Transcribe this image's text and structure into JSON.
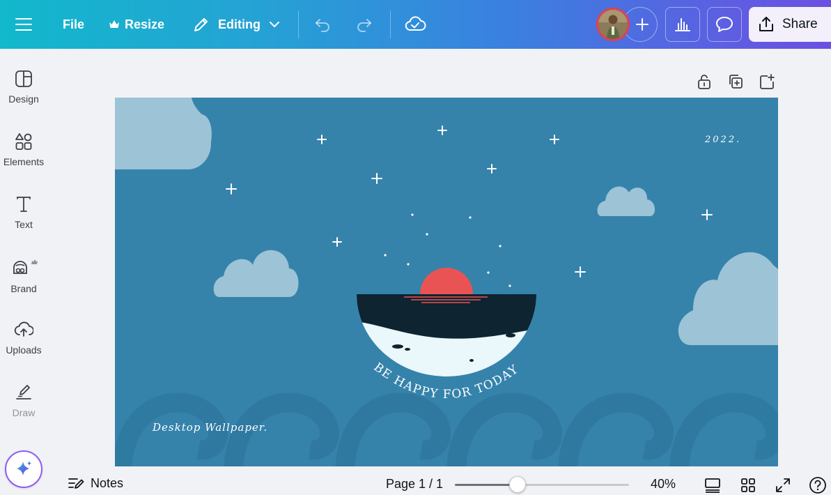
{
  "topbar": {
    "file_label": "File",
    "resize_label": "Resize",
    "editing_label": "Editing",
    "share_label": "Share"
  },
  "icons": {
    "menu": "hamburger-menu-icon",
    "crown": "crown-icon",
    "pencil": "pencil-icon",
    "chevron": "chevron-down-icon",
    "undo": "undo-icon",
    "redo": "redo-icon",
    "cloud": "cloud-check-icon",
    "add": "plus-icon",
    "analytics": "bar-chart-icon",
    "comment": "comment-icon",
    "share": "share-upload-icon"
  },
  "sidebar": {
    "items": [
      {
        "label": "Design"
      },
      {
        "label": "Elements"
      },
      {
        "label": "Text"
      },
      {
        "label": "Brand"
      },
      {
        "label": "Uploads"
      },
      {
        "label": "Draw"
      }
    ]
  },
  "canvas": {
    "year_text": "2022.",
    "arc_text": "BE HAPPY FOR TODAY.",
    "bottom_text": "Desktop Wallpaper.",
    "background_color": "#3583ab",
    "cloud_color": "#9cc3d6",
    "sun_color": "#ea5354",
    "sea_color": "#0e2430"
  },
  "footer": {
    "notes_label": "Notes",
    "page_indicator": "Page 1 / 1",
    "zoom_label": "40%",
    "zoom_fraction": 0.36
  },
  "colors": {
    "accent_start": "#12b8cc",
    "accent_end": "#6d4fe2"
  }
}
